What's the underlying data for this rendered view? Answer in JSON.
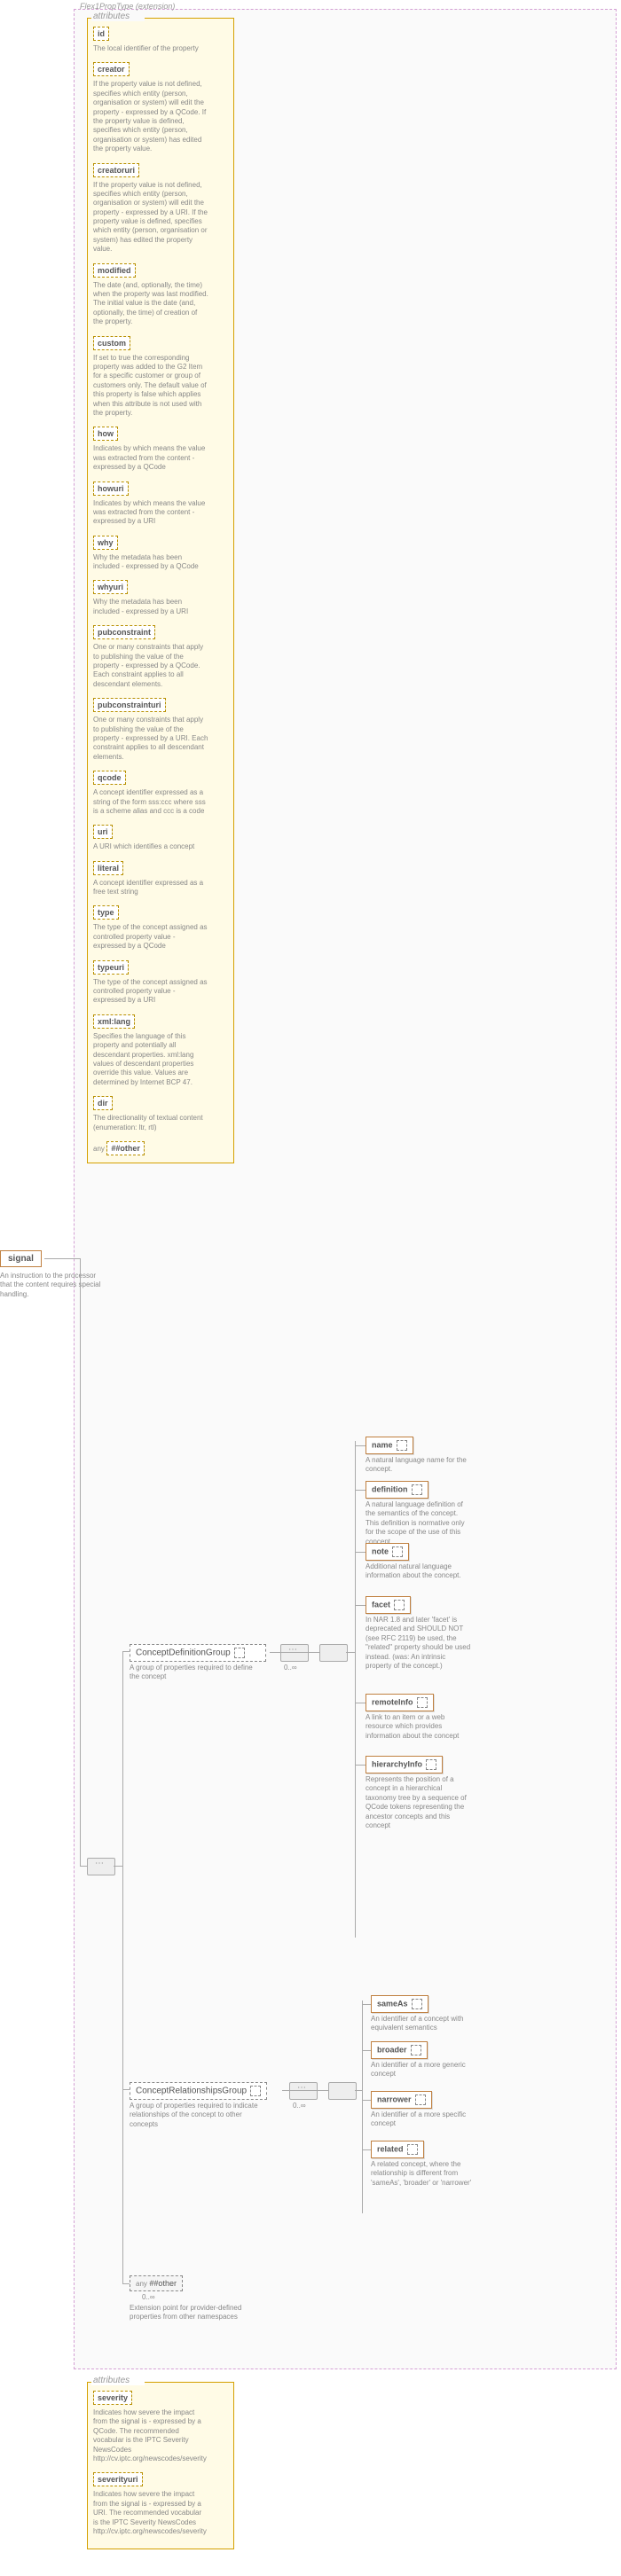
{
  "root": {
    "name": "signal",
    "desc": "An instruction to the processor that the content requires special handling."
  },
  "ext": {
    "name": "Flex1PropType",
    "suffix": "(extension)"
  },
  "attributesLabel": "attributes",
  "attrs1": [
    {
      "name": "id",
      "desc": "The local identifier of the property"
    },
    {
      "name": "creator",
      "desc": "If the property value is not defined, specifies which entity (person, organisation or system) will edit the property - expressed by a QCode. If the property value is defined, specifies which entity (person, organisation or system) has edited the property value."
    },
    {
      "name": "creatoruri",
      "desc": "If the property value is not defined, specifies which entity (person, organisation or system) will edit the property - expressed by a URI. If the property value is defined, specifies which entity (person, organisation or system) has edited the property value."
    },
    {
      "name": "modified",
      "desc": "The date (and, optionally, the time) when the property was last modified. The initial value is the date (and, optionally, the time) of creation of the property."
    },
    {
      "name": "custom",
      "desc": "If set to true the corresponding property was added to the G2 Item for a specific customer or group of customers only. The default value of this property is false which applies when this attribute is not used with the property."
    },
    {
      "name": "how",
      "desc": "Indicates by which means the value was extracted from the content - expressed by a QCode"
    },
    {
      "name": "howuri",
      "desc": "Indicates by which means the value was extracted from the content - expressed by a URI"
    },
    {
      "name": "why",
      "desc": "Why the metadata has been included - expressed by a QCode"
    },
    {
      "name": "whyuri",
      "desc": "Why the metadata has been included - expressed by a URI"
    },
    {
      "name": "pubconstraint",
      "desc": "One or many constraints that apply to publishing the value of the property - expressed by a QCode. Each constraint applies to all descendant elements."
    },
    {
      "name": "pubconstrainturi",
      "desc": "One or many constraints that apply to publishing the value of the property - expressed by a URI. Each constraint applies to all descendant elements."
    },
    {
      "name": "qcode",
      "desc": "A concept identifier expressed as a string of the form sss:ccc where sss is a scheme alias and ccc is a code"
    },
    {
      "name": "uri",
      "desc": "A URI which identifies a concept"
    },
    {
      "name": "literal",
      "desc": "A concept identifier expressed as a free text string"
    },
    {
      "name": "type",
      "desc": "The type of the concept assigned as controlled property value - expressed by a QCode"
    },
    {
      "name": "typeuri",
      "desc": "The type of the concept assigned as controlled property value - expressed by a URI"
    },
    {
      "name": "xml:lang",
      "desc": "Specifies the language of this property and potentially all descendant properties. xml:lang values of descendant properties override this value. Values are determined by Internet BCP 47."
    },
    {
      "name": "dir",
      "desc": "The directionality of textual content (enumeration: ltr, rtl)"
    }
  ],
  "anyAttr": "##other",
  "group1": {
    "name": "ConceptDefinitionGroup",
    "desc": "A group of properties required to define the concept",
    "occ": "0..∞"
  },
  "group1children": [
    {
      "name": "name",
      "desc": "A natural language name for the concept."
    },
    {
      "name": "definition",
      "desc": "A natural language definition of the semantics of the concept. This definition is normative only for the scope of the use of this concept."
    },
    {
      "name": "note",
      "desc": "Additional natural language information about the concept."
    },
    {
      "name": "facet",
      "desc": "In NAR 1.8 and later 'facet' is deprecated and SHOULD NOT (see RFC 2119) be used, the \"related\" property should be used instead. (was: An intrinsic property of the concept.)"
    },
    {
      "name": "remoteInfo",
      "desc": "A link to an item or a web resource which provides information about the concept"
    },
    {
      "name": "hierarchyInfo",
      "desc": "Represents the position of a concept in a hierarchical taxonomy tree by a sequence of QCode tokens representing the ancestor concepts and this concept"
    }
  ],
  "group2": {
    "name": "ConceptRelationshipsGroup",
    "desc": "A group of properties required to indicate relationships of the concept to other concepts",
    "occ": "0..∞"
  },
  "group2children": [
    {
      "name": "sameAs",
      "desc": "An identifier of a concept with equivalent semantics"
    },
    {
      "name": "broader",
      "desc": "An identifier of a more generic concept"
    },
    {
      "name": "narrower",
      "desc": "An identifier of a more specific concept"
    },
    {
      "name": "related",
      "desc": "A related concept, where the relationship is different from 'sameAs', 'broader' or 'narrower'"
    }
  ],
  "anyEl": {
    "name": "##other",
    "occ": "0..∞",
    "desc": "Extension point for provider-defined properties from other namespaces"
  },
  "attrs2": [
    {
      "name": "severity",
      "desc": "Indicates how severe the impact from the signal is - expressed by a QCode. The recommended vocabular is the IPTC Severity NewsCodes http://cv.iptc.org/newscodes/severity"
    },
    {
      "name": "severityuri",
      "desc": "Indicates how severe the impact from the signal is - expressed by a URI. The recommended vocabular is the IPTC Severity NewsCodes http://cv.iptc.org/newscodes/severity"
    }
  ]
}
